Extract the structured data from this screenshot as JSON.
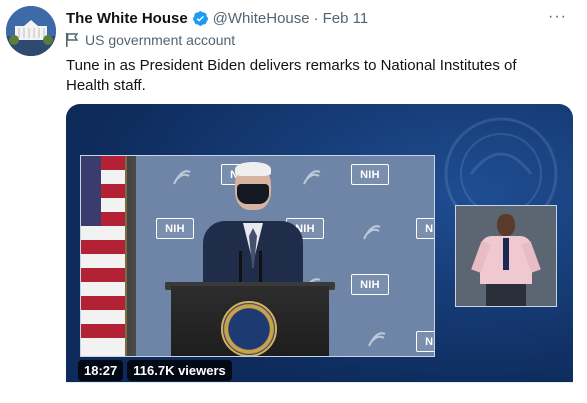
{
  "tweet": {
    "author_name": "The White House",
    "verified_icon": "verified-badge-icon",
    "handle": "@WhiteHouse",
    "separator": "·",
    "date": "Feb 11",
    "more_icon": "more-options-icon",
    "more_glyph": "···",
    "account_label": "US government account",
    "account_label_icon": "flag-icon",
    "text": "Tune in as President Biden delivers remarks to National Institutes of Health staff."
  },
  "media": {
    "type": "live-video",
    "nih_badge_text": "NIH",
    "duration": "18:27",
    "viewers": "116.7K viewers"
  },
  "colors": {
    "accent_blue": "#1d9bf0",
    "text_primary": "#0f1419",
    "text_secondary": "#536471",
    "media_background": "#123a78"
  }
}
